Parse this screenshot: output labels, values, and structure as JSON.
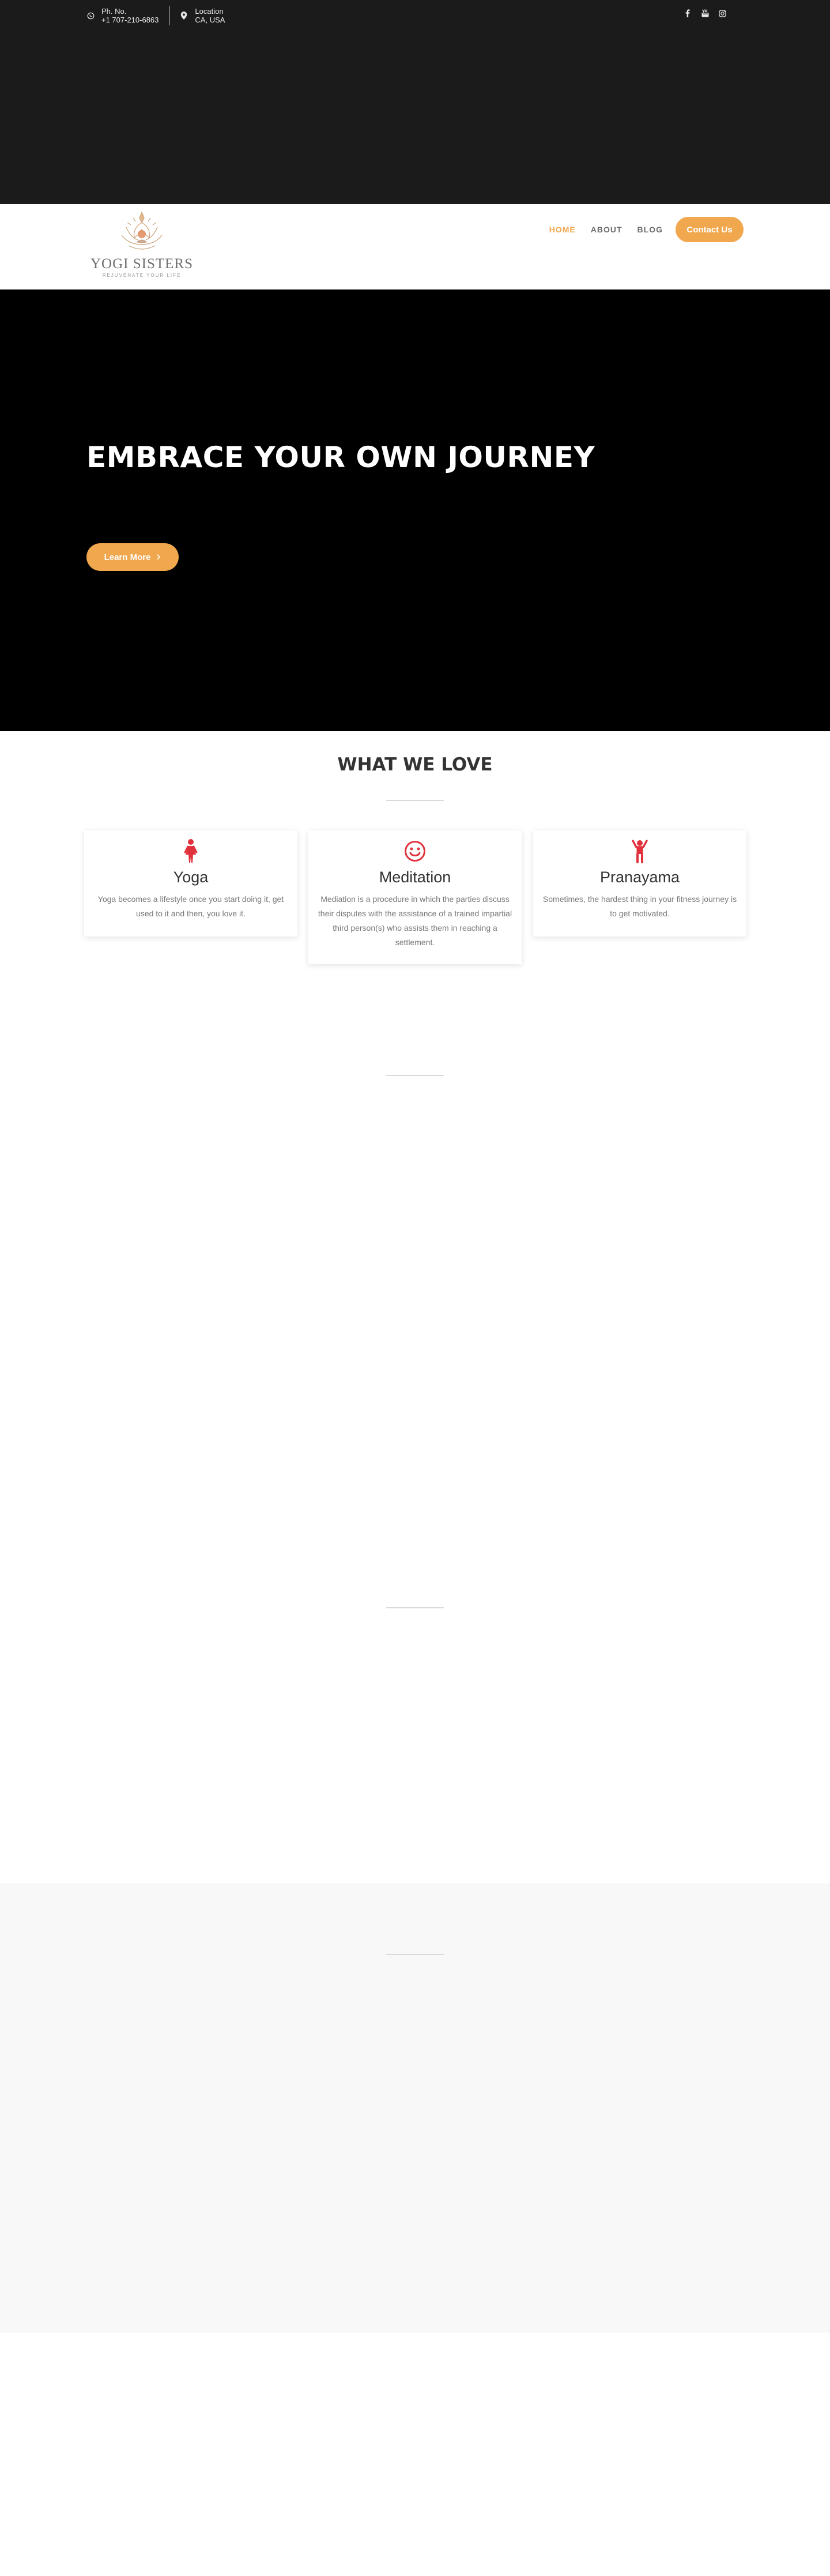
{
  "topbar": {
    "phone_label": "Ph. No.",
    "phone_value": "+1 707-210-6863",
    "location_label": "Location",
    "location_value": "CA, USA",
    "social_icons": [
      "facebook-icon",
      "youtube-icon",
      "instagram-icon"
    ]
  },
  "logo": {
    "title": "YOGI SISTERS",
    "tagline": "REJUVENATE YOUR LIFE"
  },
  "nav": {
    "items": [
      {
        "label": "HOME",
        "active": true
      },
      {
        "label": "ABOUT",
        "active": false
      },
      {
        "label": "BLOG",
        "active": false
      }
    ],
    "cta": "Contact Us"
  },
  "hero": {
    "title": "EMBRACE YOUR OWN JOURNEY",
    "button": "Learn More",
    "button_icon": "chevron-right-icon"
  },
  "love": {
    "title": "WHAT WE LOVE",
    "cards": [
      {
        "icon": "woman-figure-icon",
        "title": "Yoga",
        "text": "Yoga becomes a lifestyle once you start doing it, get used to it and then, you love it."
      },
      {
        "icon": "smile-icon",
        "title": "Meditation",
        "text": "Mediation is a procedure in which the parties discuss their disputes with the assistance of a trained impartial third person(s) who assists them in reaching a settlement."
      },
      {
        "icon": "child-figure-icon",
        "title": "Pranayama",
        "text": "Sometimes, the hardest thing in your fitness journey is to get motivated."
      }
    ]
  },
  "colors": {
    "accent": "#f0a74e",
    "topbar_bg": "#1b1b1b",
    "hero_bg": "#000000",
    "icon_red": "#e0313c",
    "band_bg": "#f8f8f8"
  }
}
